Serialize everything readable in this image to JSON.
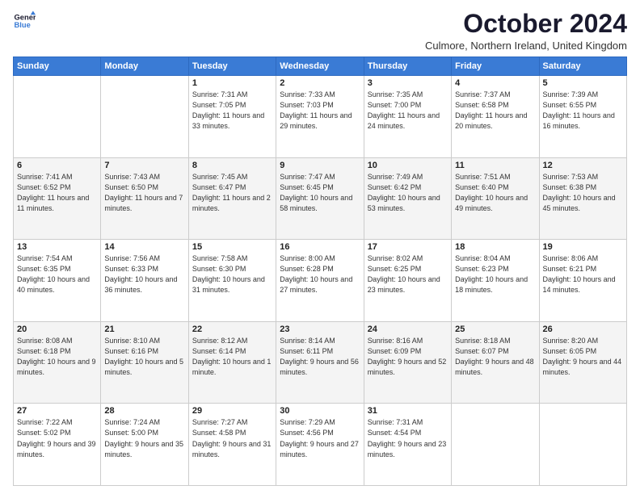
{
  "logo": {
    "line1": "General",
    "line2": "Blue"
  },
  "title": "October 2024",
  "subtitle": "Culmore, Northern Ireland, United Kingdom",
  "days_of_week": [
    "Sunday",
    "Monday",
    "Tuesday",
    "Wednesday",
    "Thursday",
    "Friday",
    "Saturday"
  ],
  "weeks": [
    [
      {
        "day": "",
        "info": ""
      },
      {
        "day": "",
        "info": ""
      },
      {
        "day": "1",
        "info": "Sunrise: 7:31 AM\nSunset: 7:05 PM\nDaylight: 11 hours\nand 33 minutes."
      },
      {
        "day": "2",
        "info": "Sunrise: 7:33 AM\nSunset: 7:03 PM\nDaylight: 11 hours\nand 29 minutes."
      },
      {
        "day": "3",
        "info": "Sunrise: 7:35 AM\nSunset: 7:00 PM\nDaylight: 11 hours\nand 24 minutes."
      },
      {
        "day": "4",
        "info": "Sunrise: 7:37 AM\nSunset: 6:58 PM\nDaylight: 11 hours\nand 20 minutes."
      },
      {
        "day": "5",
        "info": "Sunrise: 7:39 AM\nSunset: 6:55 PM\nDaylight: 11 hours\nand 16 minutes."
      }
    ],
    [
      {
        "day": "6",
        "info": "Sunrise: 7:41 AM\nSunset: 6:52 PM\nDaylight: 11 hours\nand 11 minutes."
      },
      {
        "day": "7",
        "info": "Sunrise: 7:43 AM\nSunset: 6:50 PM\nDaylight: 11 hours\nand 7 minutes."
      },
      {
        "day": "8",
        "info": "Sunrise: 7:45 AM\nSunset: 6:47 PM\nDaylight: 11 hours\nand 2 minutes."
      },
      {
        "day": "9",
        "info": "Sunrise: 7:47 AM\nSunset: 6:45 PM\nDaylight: 10 hours\nand 58 minutes."
      },
      {
        "day": "10",
        "info": "Sunrise: 7:49 AM\nSunset: 6:42 PM\nDaylight: 10 hours\nand 53 minutes."
      },
      {
        "day": "11",
        "info": "Sunrise: 7:51 AM\nSunset: 6:40 PM\nDaylight: 10 hours\nand 49 minutes."
      },
      {
        "day": "12",
        "info": "Sunrise: 7:53 AM\nSunset: 6:38 PM\nDaylight: 10 hours\nand 45 minutes."
      }
    ],
    [
      {
        "day": "13",
        "info": "Sunrise: 7:54 AM\nSunset: 6:35 PM\nDaylight: 10 hours\nand 40 minutes."
      },
      {
        "day": "14",
        "info": "Sunrise: 7:56 AM\nSunset: 6:33 PM\nDaylight: 10 hours\nand 36 minutes."
      },
      {
        "day": "15",
        "info": "Sunrise: 7:58 AM\nSunset: 6:30 PM\nDaylight: 10 hours\nand 31 minutes."
      },
      {
        "day": "16",
        "info": "Sunrise: 8:00 AM\nSunset: 6:28 PM\nDaylight: 10 hours\nand 27 minutes."
      },
      {
        "day": "17",
        "info": "Sunrise: 8:02 AM\nSunset: 6:25 PM\nDaylight: 10 hours\nand 23 minutes."
      },
      {
        "day": "18",
        "info": "Sunrise: 8:04 AM\nSunset: 6:23 PM\nDaylight: 10 hours\nand 18 minutes."
      },
      {
        "day": "19",
        "info": "Sunrise: 8:06 AM\nSunset: 6:21 PM\nDaylight: 10 hours\nand 14 minutes."
      }
    ],
    [
      {
        "day": "20",
        "info": "Sunrise: 8:08 AM\nSunset: 6:18 PM\nDaylight: 10 hours\nand 9 minutes."
      },
      {
        "day": "21",
        "info": "Sunrise: 8:10 AM\nSunset: 6:16 PM\nDaylight: 10 hours\nand 5 minutes."
      },
      {
        "day": "22",
        "info": "Sunrise: 8:12 AM\nSunset: 6:14 PM\nDaylight: 10 hours\nand 1 minute."
      },
      {
        "day": "23",
        "info": "Sunrise: 8:14 AM\nSunset: 6:11 PM\nDaylight: 9 hours\nand 56 minutes."
      },
      {
        "day": "24",
        "info": "Sunrise: 8:16 AM\nSunset: 6:09 PM\nDaylight: 9 hours\nand 52 minutes."
      },
      {
        "day": "25",
        "info": "Sunrise: 8:18 AM\nSunset: 6:07 PM\nDaylight: 9 hours\nand 48 minutes."
      },
      {
        "day": "26",
        "info": "Sunrise: 8:20 AM\nSunset: 6:05 PM\nDaylight: 9 hours\nand 44 minutes."
      }
    ],
    [
      {
        "day": "27",
        "info": "Sunrise: 7:22 AM\nSunset: 5:02 PM\nDaylight: 9 hours\nand 39 minutes."
      },
      {
        "day": "28",
        "info": "Sunrise: 7:24 AM\nSunset: 5:00 PM\nDaylight: 9 hours\nand 35 minutes."
      },
      {
        "day": "29",
        "info": "Sunrise: 7:27 AM\nSunset: 4:58 PM\nDaylight: 9 hours\nand 31 minutes."
      },
      {
        "day": "30",
        "info": "Sunrise: 7:29 AM\nSunset: 4:56 PM\nDaylight: 9 hours\nand 27 minutes."
      },
      {
        "day": "31",
        "info": "Sunrise: 7:31 AM\nSunset: 4:54 PM\nDaylight: 9 hours\nand 23 minutes."
      },
      {
        "day": "",
        "info": ""
      },
      {
        "day": "",
        "info": ""
      }
    ]
  ]
}
